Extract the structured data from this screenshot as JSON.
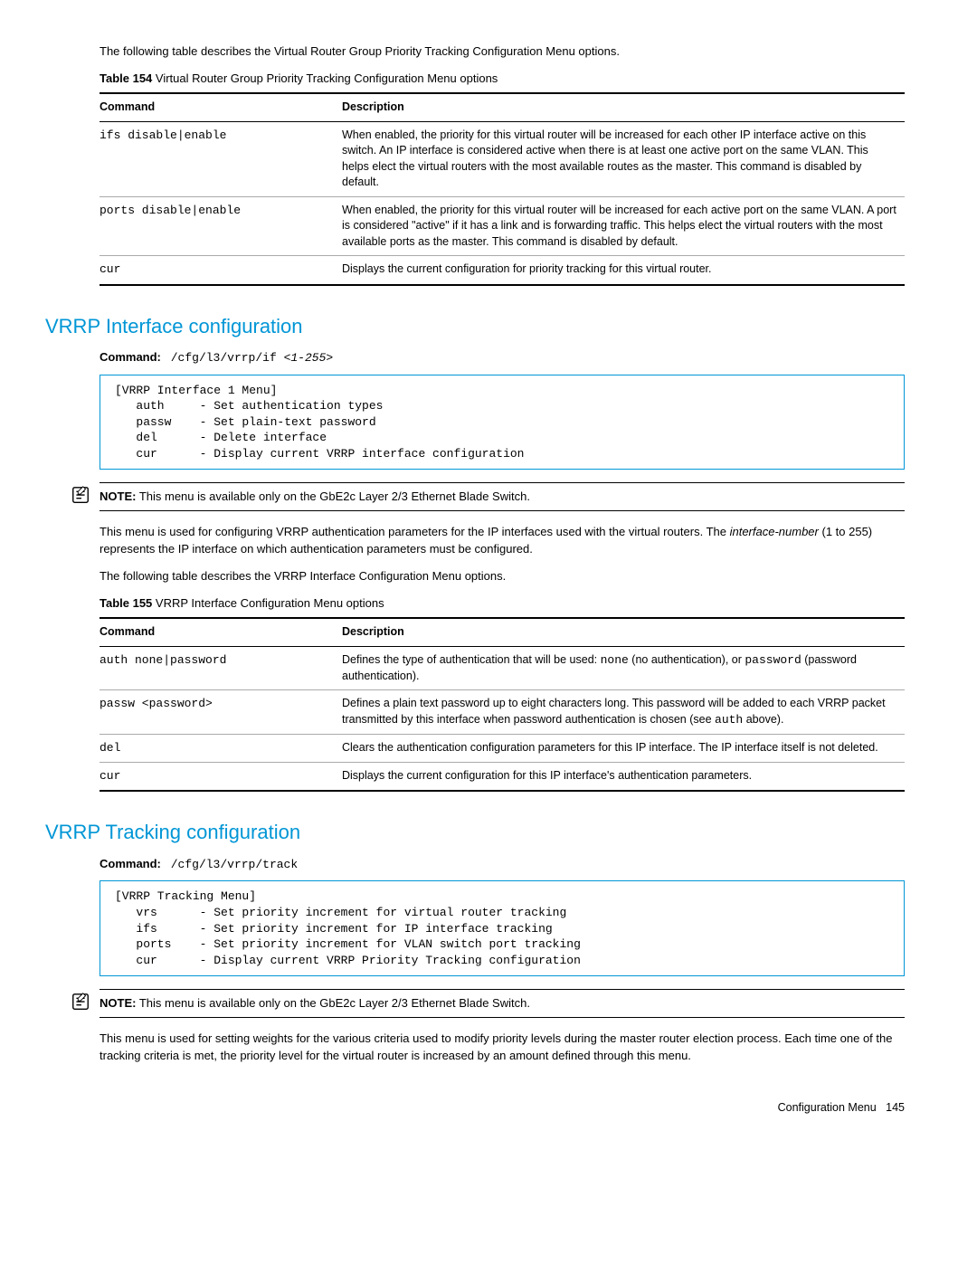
{
  "intro_para": "The following table describes the Virtual Router Group Priority Tracking Configuration Menu options.",
  "table154": {
    "caption_num": "Table 154",
    "caption_text": "  Virtual Router Group Priority Tracking Configuration Menu options",
    "head_cmd": "Command",
    "head_desc": "Description",
    "rows": [
      {
        "cmd": "ifs disable|enable",
        "desc": "When enabled, the priority for this virtual router will be increased for each other IP interface active on this switch. An IP interface is considered active when there is at least one active port on the same VLAN. This helps elect the virtual routers with the most available routes as the master. This command is disabled by default."
      },
      {
        "cmd": "ports disable|enable",
        "desc": "When enabled, the priority for this virtual router will be increased for each active port on the same VLAN. A port is considered \"active\" if it has a link and is forwarding traffic. This helps elect the virtual routers with the most available ports as the master. This command is disabled by default."
      },
      {
        "cmd": "cur",
        "desc": "Displays the current configuration for priority tracking for this virtual router."
      }
    ]
  },
  "section_if": {
    "heading": "VRRP Interface configuration",
    "cmd_label": "Command:",
    "cmd_text": "/cfg/l3/vrrp/if ",
    "cmd_arg": "<1-255>",
    "code": "[VRRP Interface 1 Menu]\n   auth     - Set authentication types\n   passw    - Set plain-text password\n   del      - Delete interface\n   cur      - Display current VRRP interface configuration",
    "note_label": "NOTE:",
    "note_text": "  This menu is available only on the GbE2c Layer 2/3 Ethernet Blade Switch.",
    "para1_a": "This menu is used for configuring VRRP authentication parameters for the IP interfaces used with the virtual routers. The ",
    "para1_ital": "interface-number",
    "para1_b": " (1 to 255) represents the IP interface on which authentication parameters must be configured.",
    "para2": "The following table describes the VRRP Interface Configuration Menu options."
  },
  "table155": {
    "caption_num": "Table 155",
    "caption_text": "  VRRP Interface Configuration Menu options",
    "head_cmd": "Command",
    "head_desc": "Description",
    "rows": [
      {
        "cmd": "auth none|password",
        "desc_a": "Defines the type of authentication that will be used: ",
        "desc_m1": "none",
        "desc_b": " (no authentication), or ",
        "desc_m2": "password",
        "desc_c": " (password authentication)."
      },
      {
        "cmd": "passw <password>",
        "desc_a": "Defines a plain text password up to eight characters long. This password will be added to each VRRP packet transmitted by this interface when password authentication is chosen (see ",
        "desc_m1": "auth",
        "desc_b": " above).",
        "desc_m2": "",
        "desc_c": ""
      },
      {
        "cmd": "del",
        "desc_a": "Clears the authentication configuration parameters for this IP interface. The IP interface itself is not deleted.",
        "desc_m1": "",
        "desc_b": "",
        "desc_m2": "",
        "desc_c": ""
      },
      {
        "cmd": "cur",
        "desc_a": "Displays the current configuration for this IP interface's authentication parameters.",
        "desc_m1": "",
        "desc_b": "",
        "desc_m2": "",
        "desc_c": ""
      }
    ]
  },
  "section_track": {
    "heading": "VRRP Tracking configuration",
    "cmd_label": "Command:",
    "cmd_text": "/cfg/l3/vrrp/track",
    "code": "[VRRP Tracking Menu]\n   vrs      - Set priority increment for virtual router tracking\n   ifs      - Set priority increment for IP interface tracking\n   ports    - Set priority increment for VLAN switch port tracking\n   cur      - Display current VRRP Priority Tracking configuration",
    "note_label": "NOTE:",
    "note_text": "  This menu is available only on the GbE2c Layer 2/3 Ethernet Blade Switch.",
    "para": "This menu is used for setting weights for the various criteria used to modify priority levels during the master router election process. Each time one of the tracking criteria is met, the priority level for the virtual router is increased by an amount defined through this menu."
  },
  "footer": {
    "text": "Configuration Menu",
    "page": "145"
  }
}
